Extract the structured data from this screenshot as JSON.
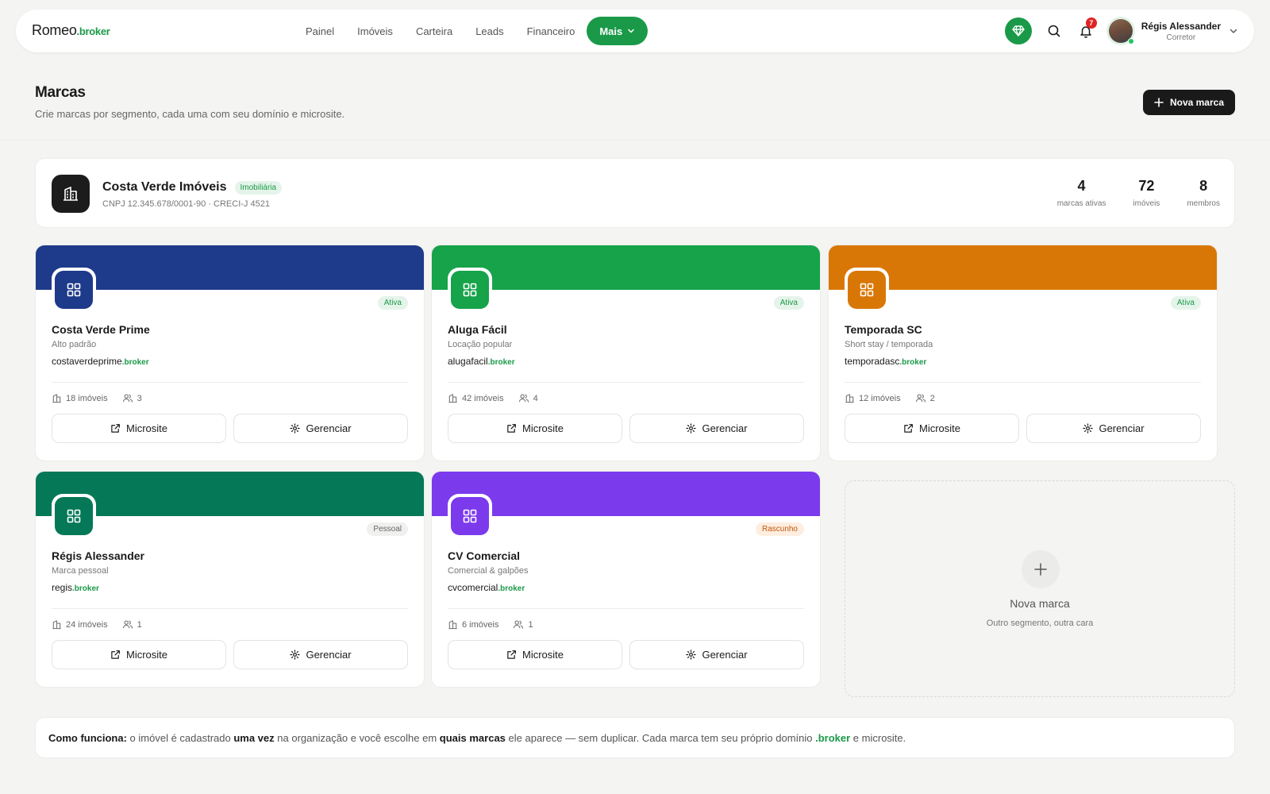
{
  "nav": {
    "logo_main": "Romeo",
    "logo_tld": ".broker",
    "items": [
      "Painel",
      "Imóveis",
      "Carteira",
      "Leads",
      "Financeiro"
    ],
    "more_label": "Mais",
    "notification_count": "7",
    "user_name": "Régis Alessander",
    "user_role": "Corretor",
    "icons": [
      "gem-icon",
      "search-icon",
      "bell-icon",
      "chevron-down-icon"
    ]
  },
  "header": {
    "title": "Marcas",
    "subtitle": "Crie marcas por segmento, cada uma com seu domínio e microsite.",
    "new_button_label": "Nova marca"
  },
  "organization": {
    "name": "Costa Verde Imóveis",
    "badge": "Imobiliária",
    "meta": "CNPJ 12.345.678/0001-90 · CRECI-J 4521",
    "stats": [
      {
        "value": "4",
        "label": "marcas ativas"
      },
      {
        "value": "72",
        "label": "imóveis"
      },
      {
        "value": "8",
        "label": "membros"
      }
    ]
  },
  "brands": [
    {
      "name": "Costa Verde Prime",
      "segment": "Alto padrão",
      "domain_name": "costaverdeprime",
      "domain_tld": ".broker",
      "status": "Ativa",
      "properties": "18 imóveis",
      "members": "3",
      "color": "#1e3a8a"
    },
    {
      "name": "Aluga Fácil",
      "segment": "Locação popular",
      "domain_name": "alugafacil",
      "domain_tld": ".broker",
      "status": "Ativa",
      "properties": "42 imóveis",
      "members": "4",
      "color": "#16a34a"
    },
    {
      "name": "Temporada SC",
      "segment": "Short stay / temporada",
      "domain_name": "temporadasc",
      "domain_tld": ".broker",
      "status": "Ativa",
      "properties": "12 imóveis",
      "members": "2",
      "color": "#d97706"
    },
    {
      "name": "Régis Alessander",
      "segment": "Marca pessoal",
      "domain_name": "regis",
      "domain_tld": ".broker",
      "status": "Pessoal",
      "properties": "24 imóveis",
      "members": "1",
      "color": "#047857"
    },
    {
      "name": "CV Comercial",
      "segment": "Comercial & galpões",
      "domain_name": "cvcomercial",
      "domain_tld": ".broker",
      "status": "Rascunho",
      "properties": "6 imóveis",
      "members": "1",
      "color": "#7c3aed"
    }
  ],
  "brand_actions": {
    "microsite": "Microsite",
    "manage": "Gerenciar"
  },
  "new_brand_card": {
    "title": "Nova marca",
    "subtitle": "Outro segmento, outra cara"
  },
  "how_it_works": {
    "label": "Como funciona:",
    "t1": " o imóvel é cadastrado ",
    "b1": "uma vez",
    "t2": " na organização e você escolhe em ",
    "b2": "quais marcas",
    "t3": " ele aparece — sem duplicar. Cada marca tem seu próprio domínio ",
    "tld": ".broker",
    "t4": " e microsite."
  },
  "colors": {
    "accent": "#1a9a48",
    "dark": "#1a1a1a"
  }
}
